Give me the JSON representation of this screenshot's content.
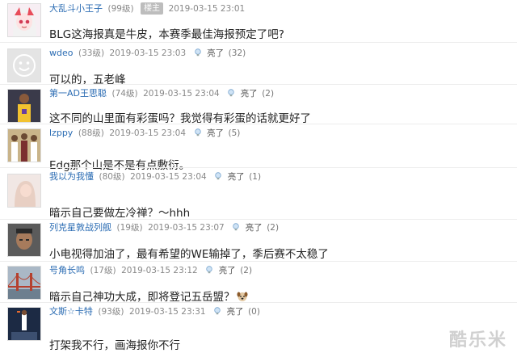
{
  "comments": [
    {
      "username": "大乱斗小王子",
      "level": "(99级)",
      "owner_badge": "楼主",
      "time": "2019-03-15 23:01",
      "text": "BLG这海报真是牛皮，本赛季最佳海报预定了吧?"
    },
    {
      "username": "wdeo",
      "level": "(33级)",
      "time": "2019-03-15 23:03",
      "like_label": "亮了",
      "like_count": "(32)",
      "text": "可以的，五老峰"
    },
    {
      "username": "第一AD王思聪",
      "level": "(74级)",
      "time": "2019-03-15 23:04",
      "like_label": "亮了",
      "like_count": "(2)",
      "text": "这不同的山里面有彩蛋吗？我觉得有彩蛋的话就更好了"
    },
    {
      "username": "lzppy",
      "level": "(88级)",
      "time": "2019-03-15 23:04",
      "like_label": "亮了",
      "like_count": "(5)",
      "text": "Edg那个山是不是有点敷衍。"
    },
    {
      "username": "我以为我懂",
      "level": "(80级)",
      "time": "2019-03-15 23:04",
      "like_label": "亮了",
      "like_count": "(1)",
      "text": "暗示自己要做左冷禅？～hhh"
    },
    {
      "username": "列克星敦战列舰",
      "level": "(19级)",
      "time": "2019-03-15 23:07",
      "like_label": "亮了",
      "like_count": "(2)",
      "text": "小电视得加油了，最有希望的WE输掉了，季后赛不太稳了"
    },
    {
      "username": "号角长鸣",
      "level": "(17级)",
      "time": "2019-03-15 23:12",
      "like_label": "亮了",
      "like_count": "(2)",
      "text": "暗示自己神功大成，即将登记五岳盟？"
    },
    {
      "username": "文斯☆卡特",
      "level": "(93级)",
      "time": "2019-03-15 23:31",
      "like_label": "亮了",
      "like_count": "(0)",
      "text": "打架我不行，画海报你不行"
    }
  ],
  "watermark": "酷乐米",
  "colors": {
    "username": "#2b6cb3",
    "meta": "#888888",
    "owner_badge_bg": "#bdbdbd"
  }
}
